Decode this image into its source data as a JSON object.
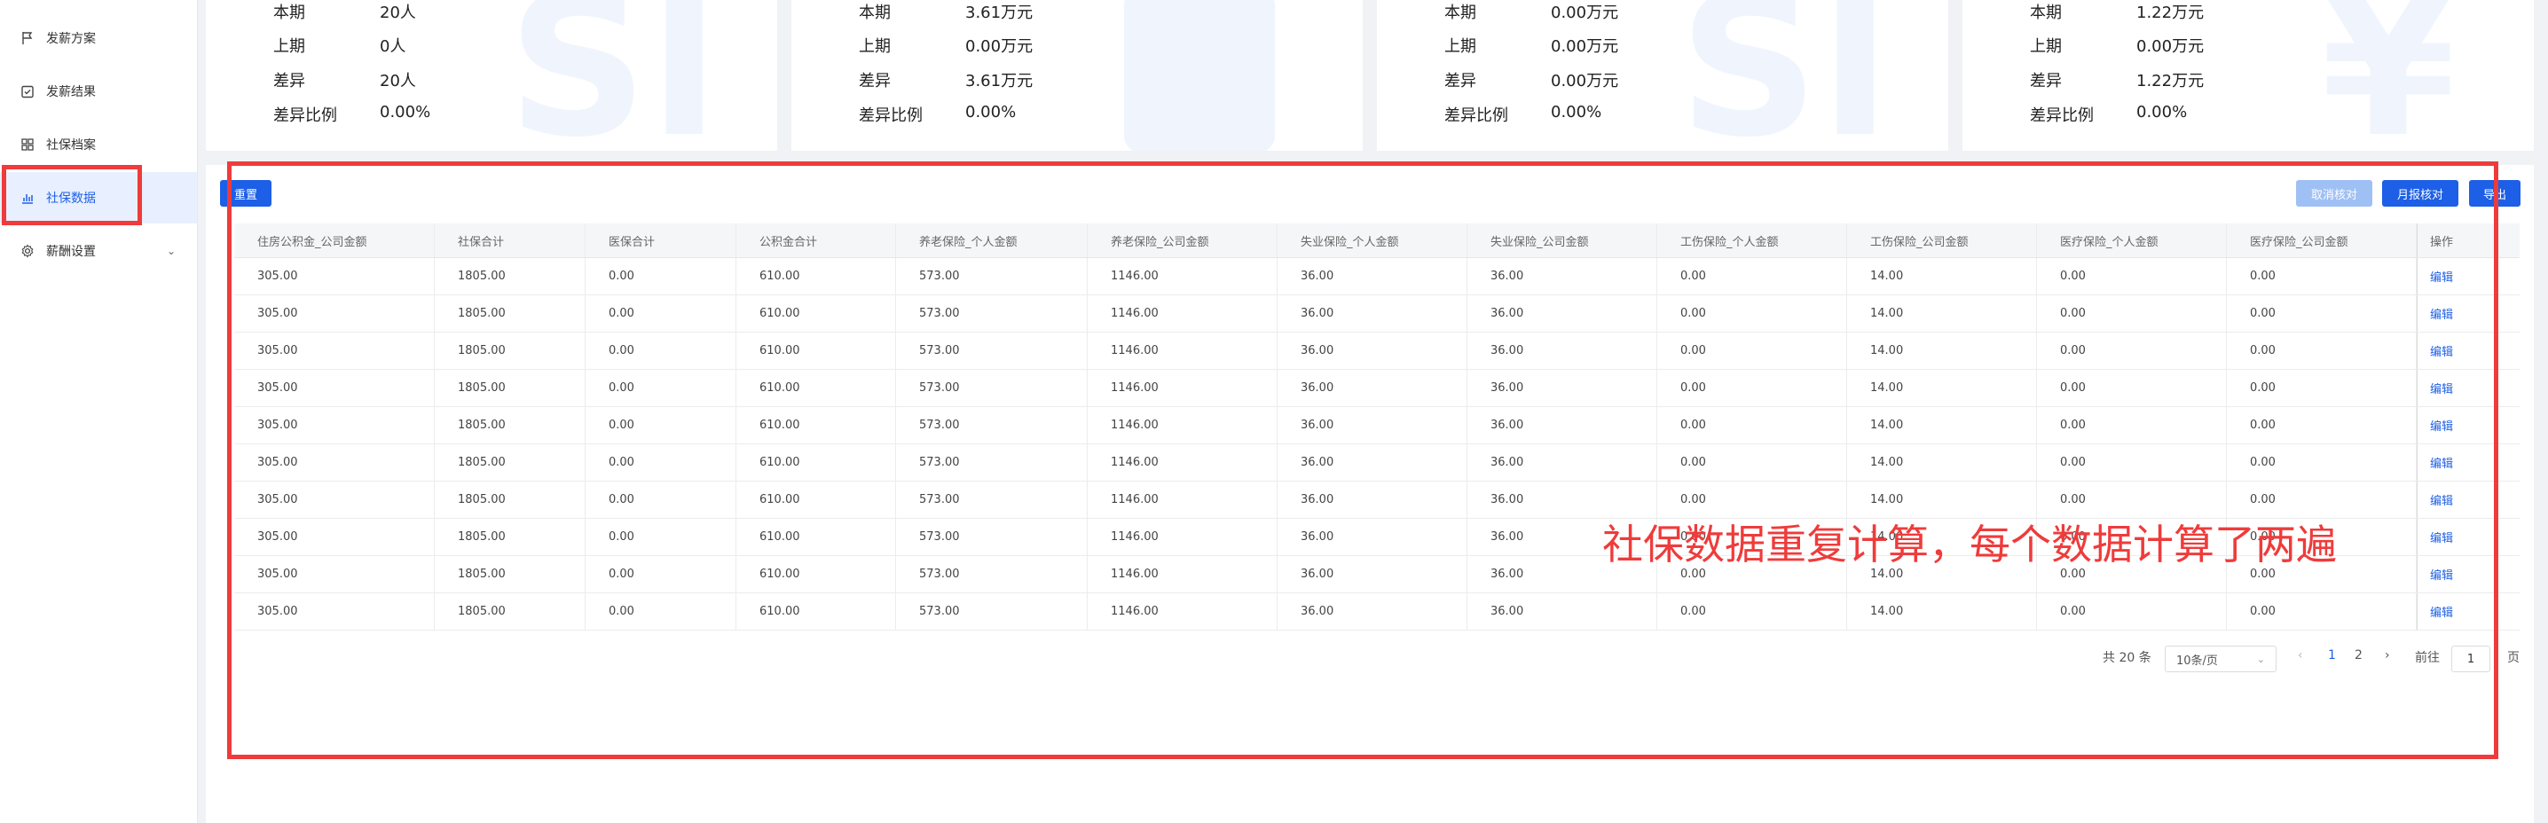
{
  "sidebar": {
    "items": [
      {
        "label": "发薪方案",
        "icon": "flag-icon"
      },
      {
        "label": "发薪结果",
        "icon": "calendar-check-icon"
      },
      {
        "label": "社保档案",
        "icon": "grid-icon"
      },
      {
        "label": "社保数据",
        "icon": "bar-chart-icon",
        "active": true
      },
      {
        "label": "薪酬设置",
        "icon": "gear-icon",
        "has_children": true
      }
    ]
  },
  "stats": [
    {
      "rows": [
        [
          "本期",
          "20人"
        ],
        [
          "上期",
          "0人"
        ],
        [
          "差异",
          "20人"
        ],
        [
          "差异比例",
          "0.00%"
        ]
      ],
      "watermark_icon": "si-logo-icon"
    },
    {
      "rows": [
        [
          "本期",
          "3.61万元"
        ],
        [
          "上期",
          "0.00万元"
        ],
        [
          "差异",
          "3.61万元"
        ],
        [
          "差异比例",
          "0.00%"
        ]
      ],
      "watermark_icon": "database-icon"
    },
    {
      "rows": [
        [
          "本期",
          "0.00万元"
        ],
        [
          "上期",
          "0.00万元"
        ],
        [
          "差异",
          "0.00万元"
        ],
        [
          "差异比例",
          "0.00%"
        ]
      ],
      "watermark_icon": "si-logo-icon"
    },
    {
      "rows": [
        [
          "本期",
          "1.22万元"
        ],
        [
          "上期",
          "0.00万元"
        ],
        [
          "差异",
          "1.22万元"
        ],
        [
          "差异比例",
          "0.00%"
        ]
      ],
      "watermark_icon": "yen-icon"
    }
  ],
  "toolbar": {
    "reset_label": "重置",
    "cancel_check_label": "取消核对",
    "monthly_check_label": "月报核对",
    "export_label": "导出"
  },
  "table": {
    "columns": [
      "住房公积金_公司金额",
      "社保合计",
      "医保合计",
      "公积金合计",
      "养老保险_个人金额",
      "养老保险_公司金额",
      "失业保险_个人金额",
      "失业保险_公司金额",
      "工伤保险_个人金额",
      "工伤保险_公司金额",
      "医疗保险_个人金额",
      "医疗保险_公司金额",
      "操作"
    ],
    "rows": [
      [
        "305.00",
        "1805.00",
        "0.00",
        "610.00",
        "573.00",
        "1146.00",
        "36.00",
        "36.00",
        "0.00",
        "14.00",
        "0.00",
        "0.00",
        "编辑"
      ],
      [
        "305.00",
        "1805.00",
        "0.00",
        "610.00",
        "573.00",
        "1146.00",
        "36.00",
        "36.00",
        "0.00",
        "14.00",
        "0.00",
        "0.00",
        "编辑"
      ],
      [
        "305.00",
        "1805.00",
        "0.00",
        "610.00",
        "573.00",
        "1146.00",
        "36.00",
        "36.00",
        "0.00",
        "14.00",
        "0.00",
        "0.00",
        "编辑"
      ],
      [
        "305.00",
        "1805.00",
        "0.00",
        "610.00",
        "573.00",
        "1146.00",
        "36.00",
        "36.00",
        "0.00",
        "14.00",
        "0.00",
        "0.00",
        "编辑"
      ],
      [
        "305.00",
        "1805.00",
        "0.00",
        "610.00",
        "573.00",
        "1146.00",
        "36.00",
        "36.00",
        "0.00",
        "14.00",
        "0.00",
        "0.00",
        "编辑"
      ],
      [
        "305.00",
        "1805.00",
        "0.00",
        "610.00",
        "573.00",
        "1146.00",
        "36.00",
        "36.00",
        "0.00",
        "14.00",
        "0.00",
        "0.00",
        "编辑"
      ],
      [
        "305.00",
        "1805.00",
        "0.00",
        "610.00",
        "573.00",
        "1146.00",
        "36.00",
        "36.00",
        "0.00",
        "14.00",
        "0.00",
        "0.00",
        "编辑"
      ],
      [
        "305.00",
        "1805.00",
        "0.00",
        "610.00",
        "573.00",
        "1146.00",
        "36.00",
        "36.00",
        "0.00",
        "14.00",
        "0.00",
        "0.00",
        "编辑"
      ],
      [
        "305.00",
        "1805.00",
        "0.00",
        "610.00",
        "573.00",
        "1146.00",
        "36.00",
        "36.00",
        "0.00",
        "14.00",
        "0.00",
        "0.00",
        "编辑"
      ],
      [
        "305.00",
        "1805.00",
        "0.00",
        "610.00",
        "573.00",
        "1146.00",
        "36.00",
        "36.00",
        "0.00",
        "14.00",
        "0.00",
        "0.00",
        "编辑"
      ]
    ]
  },
  "pagination": {
    "total_text": "共 20 条",
    "page_size": "10条/页",
    "prev_icon": "chevron-left-icon",
    "pages": [
      "1",
      "2"
    ],
    "current_page": "1",
    "next_icon": "chevron-right-icon",
    "goto_label": "前往",
    "goto_value": "1",
    "page_suffix": "页"
  },
  "annotation": {
    "text": "社保数据重复计算，每个数据计算了两遍",
    "color": "#ef3b3b"
  },
  "colors": {
    "accent": "#1d5fe6",
    "highlight": "#ef3b3b"
  }
}
